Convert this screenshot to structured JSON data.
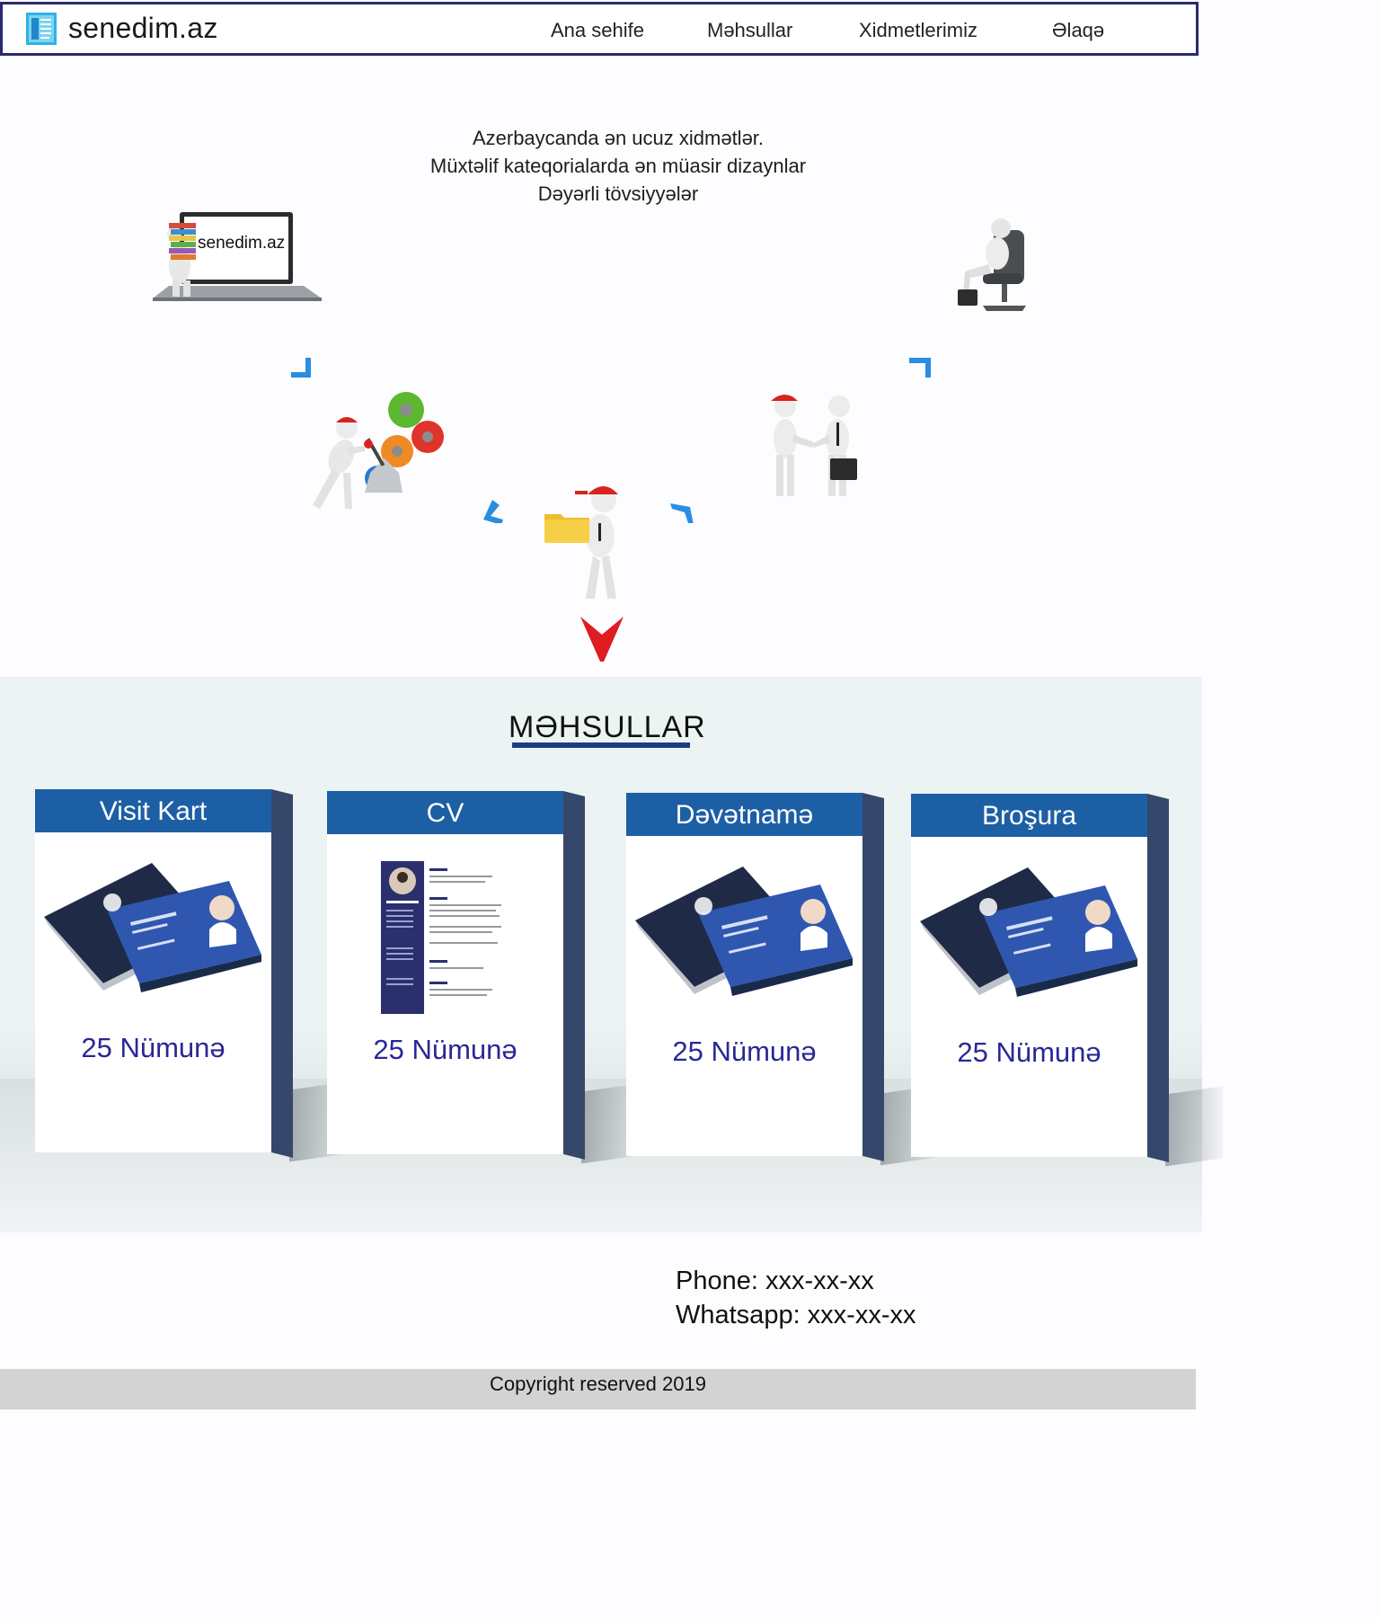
{
  "header": {
    "logo_icon": "document-logo-icon",
    "site_name": "senedim.az",
    "nav": [
      "Ana sehife",
      "Məhsullar",
      "Xidmetlerimiz",
      "Əlaqə"
    ]
  },
  "hero": {
    "lines": [
      "Azerbaycanda ən ucuz xidmətlər.",
      "Müxtəlif kateqorialarda ən müasir dizaynlar",
      "Dəyərli tövsiyyələr"
    ],
    "laptop_screen_text": "senedim.az",
    "illustrations": [
      "laptop-with-books-figure",
      "figure-with-gears",
      "figure-with-folder",
      "handshake-figures",
      "figure-in-office-chair"
    ],
    "arrow_color": "#2a8de0",
    "down_arrow_color": "#e01b22"
  },
  "products": {
    "title": "MƏHSULLAR",
    "cards": [
      {
        "name": "Visit Kart",
        "count": "25 Nümunə",
        "image": "business-cards-image"
      },
      {
        "name": "CV",
        "count": "25 Nümunə",
        "image": "cv-document-image"
      },
      {
        "name": "Dəvətnamə",
        "count": "25 Nümunə",
        "image": "business-cards-image"
      },
      {
        "name": "Broşura",
        "count": "25 Nümunə",
        "image": "business-cards-image"
      }
    ],
    "header_color": "#1d5fa5",
    "count_color": "#2a2796"
  },
  "contact": {
    "phone": "Phone: xxx-xx-xx",
    "whatsapp": "Whatsapp: xxx-xx-xx"
  },
  "footer": {
    "copyright": "Copyright reserved 2019"
  }
}
